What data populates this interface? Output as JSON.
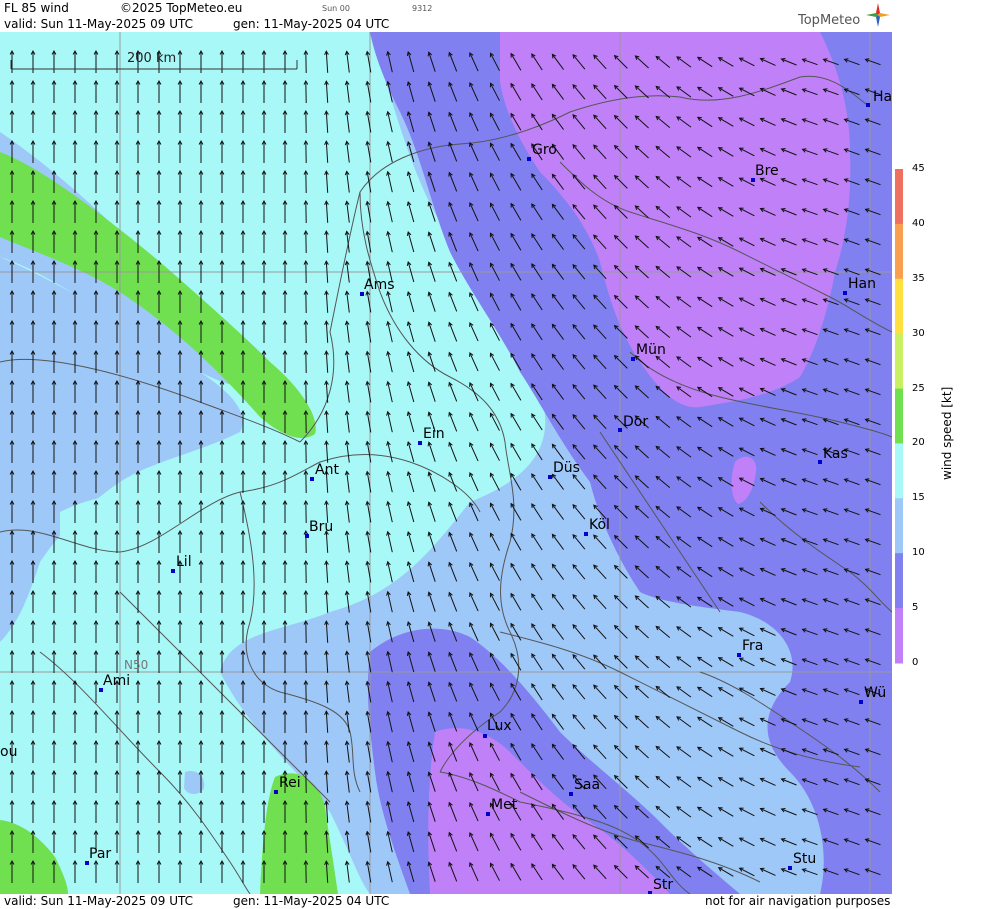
{
  "header": {
    "title": "FL 85 wind",
    "copyright": "©2025 TopMeteo.eu",
    "run": "Sun 00",
    "code": "9312",
    "valid": "valid:  Sun  11-May-2025  09 UTC",
    "gen": "gen: 11-May-2025 04 UTC",
    "logo": "TopMeteo"
  },
  "footer": {
    "valid": "valid:  Sun  11-May-2025  09 UTC",
    "gen": "gen: 11-May-2025 04 UTC",
    "disclaimer": "not for air navigation purposes"
  },
  "scale_bar": "200 km",
  "grid_label": "N50",
  "legend": {
    "title": "wind  speed  [kt]",
    "ticks": [
      "45",
      "40",
      "35",
      "30",
      "25",
      "20",
      "15",
      "10",
      "5",
      "0"
    ],
    "colors": [
      "#f07060",
      "#f8a050",
      "#ffe040",
      "#c8f060",
      "#70e050",
      "#a8f8f8",
      "#9ec8f8",
      "#8080f0",
      "#c080f8"
    ]
  },
  "cities": [
    {
      "name": "Gro"
    },
    {
      "name": "Bre"
    },
    {
      "name": "Ha"
    },
    {
      "name": "Ams"
    },
    {
      "name": "Han"
    },
    {
      "name": "Mün"
    },
    {
      "name": "Ein"
    },
    {
      "name": "Dor"
    },
    {
      "name": "Kas"
    },
    {
      "name": "Ant"
    },
    {
      "name": "Düs"
    },
    {
      "name": "Köl"
    },
    {
      "name": "Bru"
    },
    {
      "name": "Lil"
    },
    {
      "name": "Fra"
    },
    {
      "name": "Ami"
    },
    {
      "name": "Wü"
    },
    {
      "name": "Lux"
    },
    {
      "name": "ou"
    },
    {
      "name": "Rei"
    },
    {
      "name": "Saa"
    },
    {
      "name": "Met"
    },
    {
      "name": "Par"
    },
    {
      "name": "Stu"
    },
    {
      "name": "Str"
    }
  ]
}
